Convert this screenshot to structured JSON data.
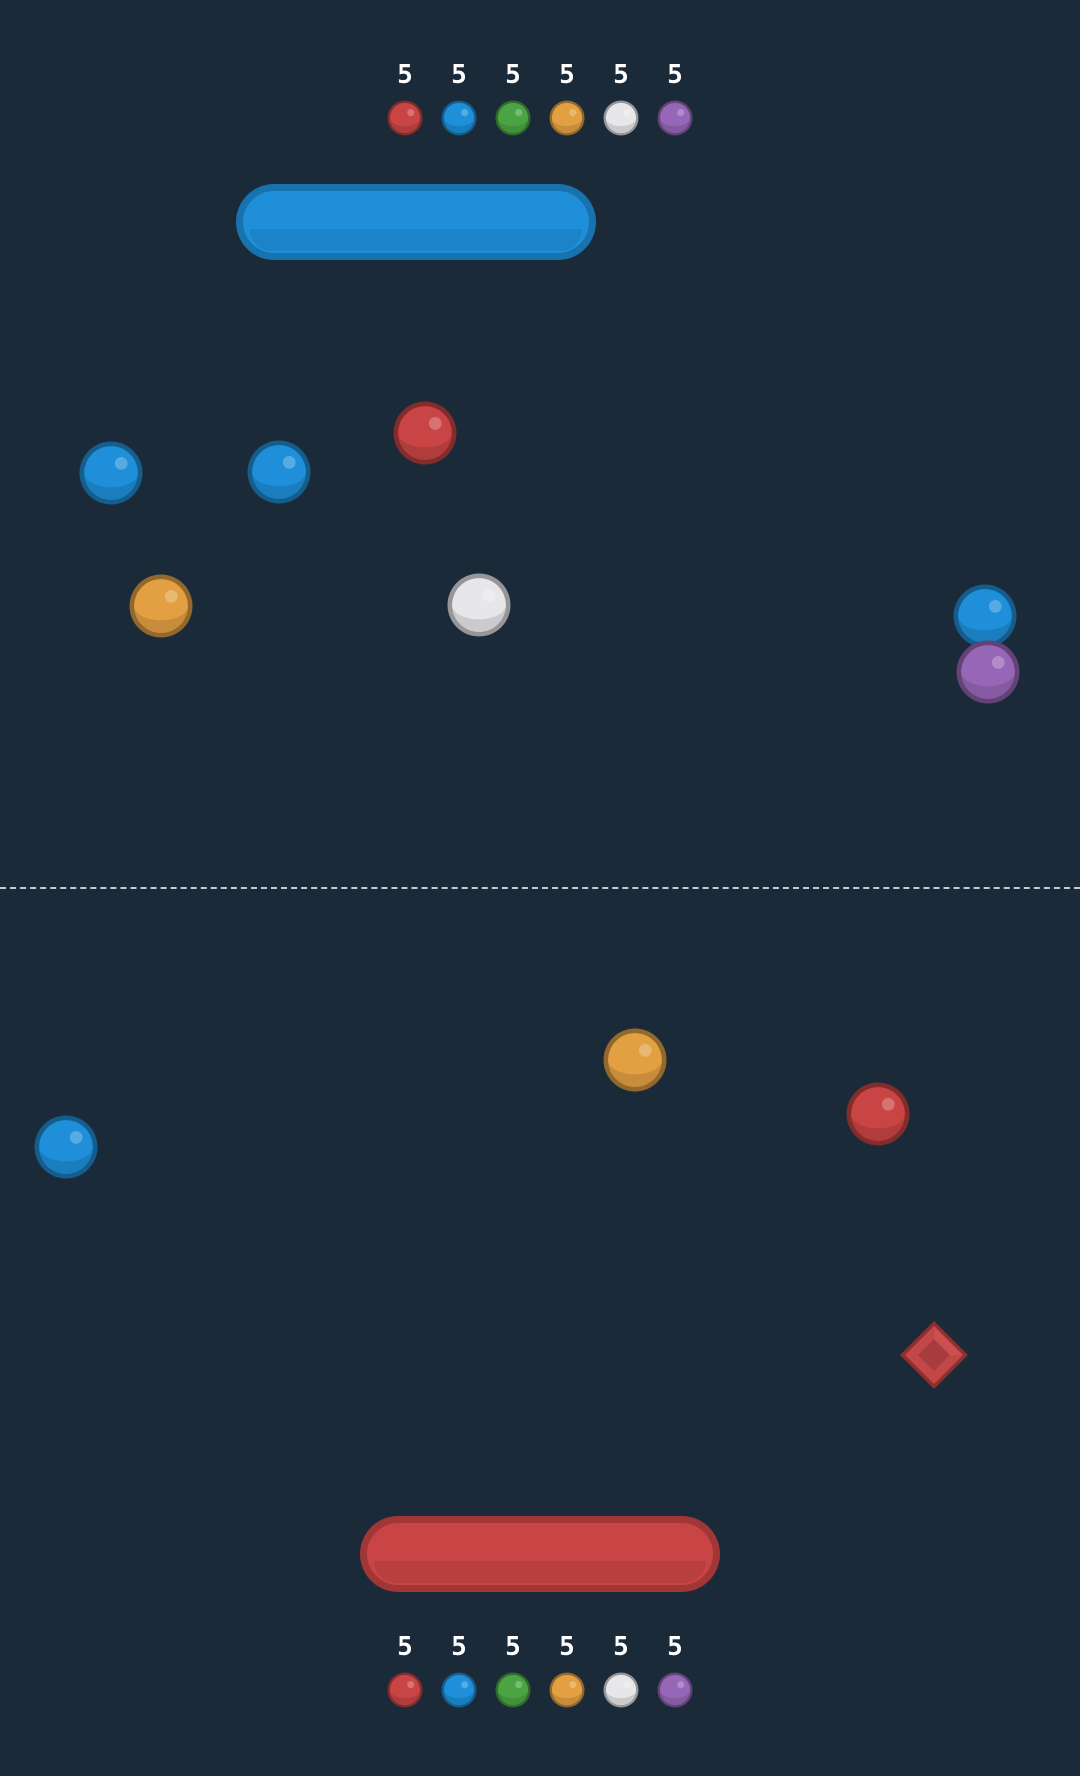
{
  "colors": {
    "background": "#1b2a38",
    "red": "#c94444",
    "blue": "#1e8fd8",
    "green": "#4aa444",
    "orange": "#e2a043",
    "white": "#e7e7ea",
    "purple": "#9666b7"
  },
  "top_scoreboard": {
    "scores": [
      {
        "color": "red",
        "value": "5"
      },
      {
        "color": "blue",
        "value": "5"
      },
      {
        "color": "green",
        "value": "5"
      },
      {
        "color": "orange",
        "value": "5"
      },
      {
        "color": "white",
        "value": "5"
      },
      {
        "color": "purple",
        "value": "5"
      }
    ]
  },
  "bottom_scoreboard": {
    "scores": [
      {
        "color": "red",
        "value": "5"
      },
      {
        "color": "blue",
        "value": "5"
      },
      {
        "color": "green",
        "value": "5"
      },
      {
        "color": "orange",
        "value": "5"
      },
      {
        "color": "white",
        "value": "5"
      },
      {
        "color": "purple",
        "value": "5"
      }
    ]
  },
  "top_paddle": {
    "color": "blue"
  },
  "bottom_paddle": {
    "color": "red"
  },
  "balls": [
    {
      "color": "blue"
    },
    {
      "color": "blue"
    },
    {
      "color": "red"
    },
    {
      "color": "orange"
    },
    {
      "color": "white"
    },
    {
      "color": "blue"
    },
    {
      "color": "purple"
    },
    {
      "color": "orange"
    },
    {
      "color": "red"
    },
    {
      "color": "blue"
    }
  ],
  "powerup": {
    "icon": "red-diamond-icon",
    "color": "red"
  }
}
